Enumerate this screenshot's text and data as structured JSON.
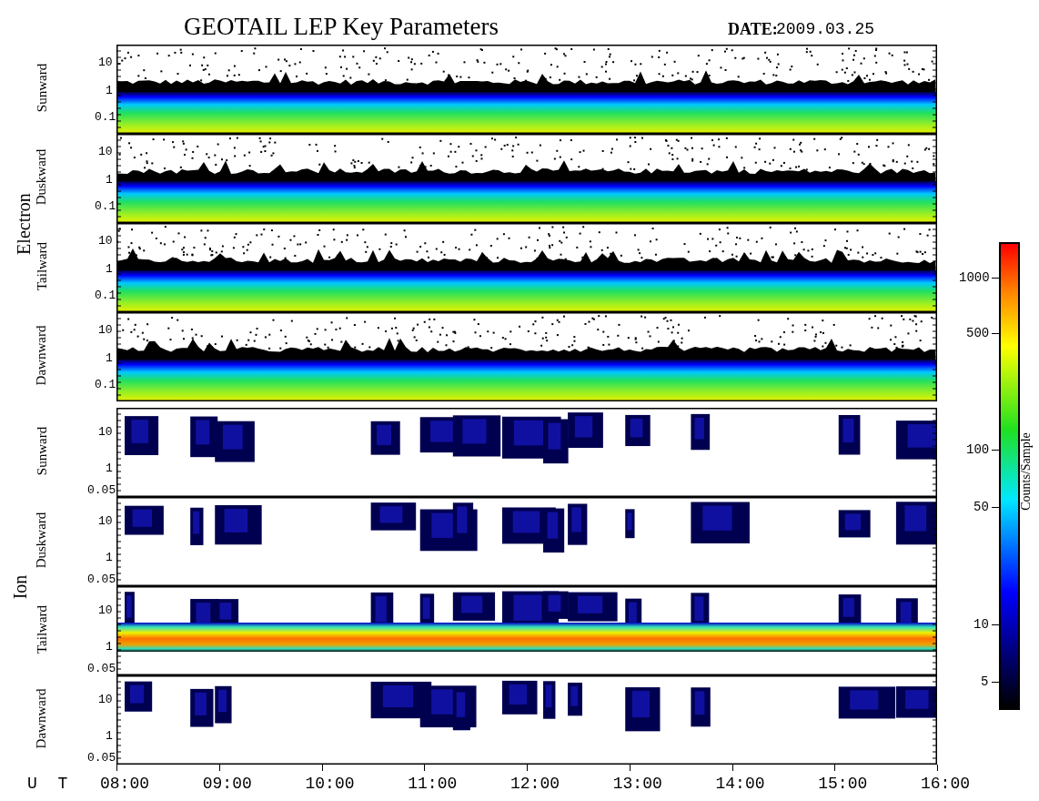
{
  "title": "GEOTAIL LEP Key Parameters",
  "date_label": "DATE:",
  "date": "2009.03.25",
  "groups": [
    {
      "name": "Electron",
      "panels": [
        {
          "label": "Sunward",
          "kind": "electron",
          "y_ticks": [
            "10",
            "1",
            "0.1"
          ]
        },
        {
          "label": "Duskward",
          "kind": "electron",
          "y_ticks": [
            "10",
            "1",
            "0.1"
          ]
        },
        {
          "label": "Tailward",
          "kind": "electron",
          "y_ticks": [
            "10",
            "1",
            "0.1"
          ]
        },
        {
          "label": "Dawnward",
          "kind": "electron",
          "y_ticks": [
            "10",
            "1",
            "0.1"
          ]
        }
      ]
    },
    {
      "name": "Ion",
      "panels": [
        {
          "label": "Sunward",
          "kind": "ion",
          "y_ticks": [
            "10",
            "1",
            "0.05"
          ]
        },
        {
          "label": "Duskward",
          "kind": "ion",
          "y_ticks": [
            "10",
            "1",
            "0.05"
          ]
        },
        {
          "label": "Tailward",
          "kind": "ion_band",
          "y_ticks": [
            "10",
            "1",
            "0.05"
          ]
        },
        {
          "label": "Dawnward",
          "kind": "ion",
          "y_ticks": [
            "10",
            "1",
            "0.05"
          ]
        }
      ]
    }
  ],
  "time_axis": {
    "label": "U T",
    "ticks": [
      "08:00",
      "09:00",
      "10:00",
      "11:00",
      "12:00",
      "13:00",
      "14:00",
      "15:00",
      "16:00"
    ]
  },
  "colorbar": {
    "title": "Counts/Sample",
    "ticks": [
      "1000",
      "500",
      "100",
      "50",
      "10",
      "5"
    ]
  }
}
